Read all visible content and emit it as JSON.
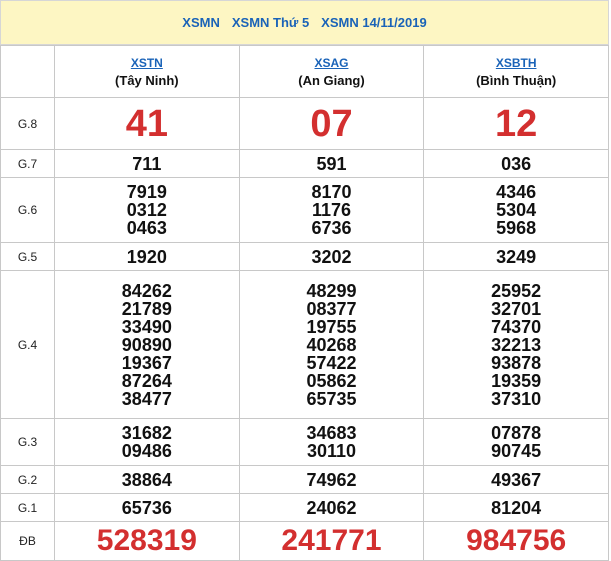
{
  "header": {
    "links": [
      "XSMN",
      "XSMN Thứ 5",
      "XSMN 14/11/2019"
    ]
  },
  "provinces": [
    {
      "code": "XSTN",
      "name": "(Tây Ninh)"
    },
    {
      "code": "XSAG",
      "name": "(An Giang)"
    },
    {
      "code": "XSBTH",
      "name": "(Bình Thuận)"
    }
  ],
  "labels": {
    "g8": "G.8",
    "g7": "G.7",
    "g6": "G.6",
    "g5": "G.5",
    "g4": "G.4",
    "g3": "G.3",
    "g2": "G.2",
    "g1": "G.1",
    "db": "ĐB"
  },
  "results": {
    "g8": [
      "41",
      "07",
      "12"
    ],
    "g7": [
      "711",
      "591",
      "036"
    ],
    "g6": [
      [
        "7919",
        "0312",
        "0463"
      ],
      [
        "8170",
        "1176",
        "6736"
      ],
      [
        "4346",
        "5304",
        "5968"
      ]
    ],
    "g5": [
      "1920",
      "3202",
      "3249"
    ],
    "g4": [
      [
        "84262",
        "21789",
        "33490",
        "90890",
        "19367",
        "87264",
        "38477"
      ],
      [
        "48299",
        "08377",
        "19755",
        "40268",
        "57422",
        "05862",
        "65735"
      ],
      [
        "25952",
        "32701",
        "74370",
        "32213",
        "93878",
        "19359",
        "37310"
      ]
    ],
    "g3": [
      [
        "31682",
        "09486"
      ],
      [
        "34683",
        "30110"
      ],
      [
        "07878",
        "90745"
      ]
    ],
    "g2": [
      "38864",
      "74962",
      "49367"
    ],
    "g1": [
      "65736",
      "24062",
      "81204"
    ],
    "db": [
      "528319",
      "241771",
      "984756"
    ]
  },
  "colors": {
    "link": "#1a63b8",
    "highlight": "#d32f2f",
    "header_bg": "#fdf6c3"
  }
}
